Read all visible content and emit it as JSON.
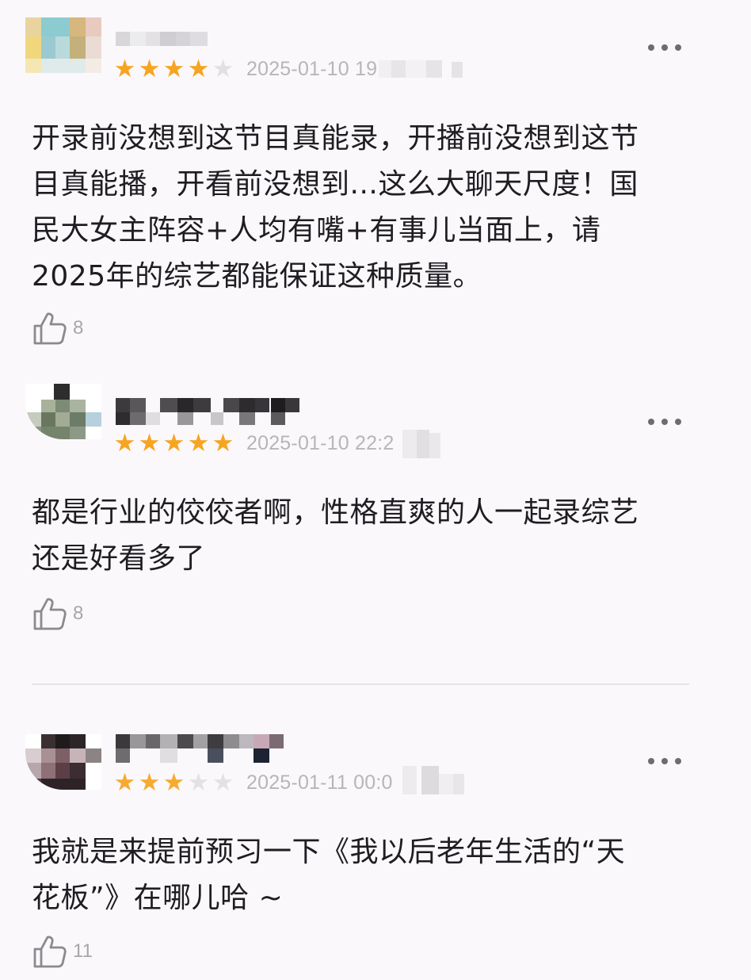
{
  "reviews": [
    {
      "rating": 4,
      "max_rating": 5,
      "date": "2025-01-10 19",
      "comment_lines": [
        "开录前没想到这节目真能录，开播前没想到这节",
        "目真能播，开看前没想到...这么大聊天尺度！国",
        "民大女主阵容+人均有嘴+有事儿当面上，请",
        "2025年的综艺都能保证这种质量。"
      ],
      "likes": "8",
      "more_icon": "more-dots-icon",
      "like_icon": "thumbs-up-icon"
    },
    {
      "rating": 5,
      "max_rating": 5,
      "date": "2025-01-10 22:2",
      "comment_lines": [
        "都是行业的佼佼者啊，性格直爽的人一起录综艺",
        "还是好看多了"
      ],
      "likes": "8",
      "more_icon": "more-dots-icon",
      "like_icon": "thumbs-up-icon"
    },
    {
      "rating": 3,
      "max_rating": 5,
      "date": "2025-01-11 00:0",
      "comment_lines": [
        "我就是来提前预习一下《我以后老年生活的“天",
        "花板”》在哪儿哈 ~"
      ],
      "likes": "11",
      "more_icon": "more-dots-icon",
      "like_icon": "thumbs-up-icon"
    }
  ],
  "colors": {
    "star_on": "#f7a420",
    "star_off": "#e2e0e3",
    "background": "#fbf8fb",
    "meta_text": "#b8b5ba"
  }
}
